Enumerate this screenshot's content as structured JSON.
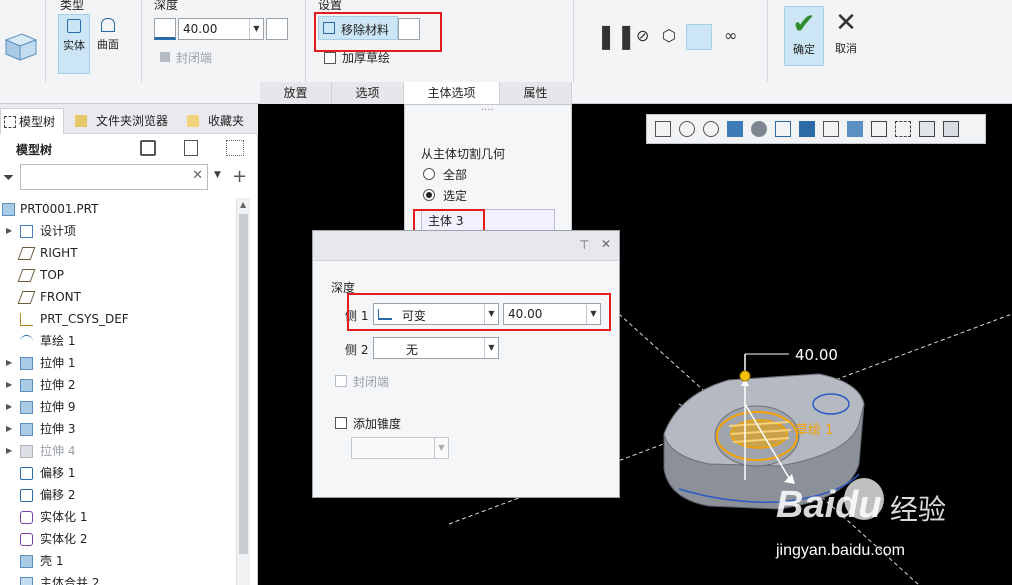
{
  "ribbon": {
    "type_group": {
      "title": "类型",
      "solid_label": "实体",
      "surface_label": "曲面"
    },
    "depth_group": {
      "title": "深度",
      "value": "40.00",
      "cap_ends_label": "封闭端"
    },
    "settings_group": {
      "title": "设置",
      "remove_material_label": "移除材料",
      "thicken_label": "加厚草绘"
    },
    "tabs": [
      {
        "label": "放置"
      },
      {
        "label": "选项"
      },
      {
        "label": "主体选项"
      },
      {
        "label": "属性"
      }
    ],
    "ok_label": "确定",
    "cancel_label": "取消"
  },
  "left_panel": {
    "tabs": [
      {
        "label": "模型树"
      },
      {
        "label": "文件夹浏览器"
      },
      {
        "label": "收藏夹"
      }
    ],
    "tree_title": "模型树",
    "filter_placeholder": "",
    "tree": [
      {
        "label": "PRT0001.PRT",
        "icon": "part-icon"
      },
      {
        "label": "设计项",
        "icon": "design-items-icon"
      },
      {
        "label": "RIGHT",
        "icon": "datum-plane-icon"
      },
      {
        "label": "TOP",
        "icon": "datum-plane-icon"
      },
      {
        "label": "FRONT",
        "icon": "datum-plane-icon"
      },
      {
        "label": "PRT_CSYS_DEF",
        "icon": "csys-icon"
      },
      {
        "label": "草绘 1",
        "icon": "sketch-icon"
      },
      {
        "label": "拉伸 1",
        "icon": "extrude-icon"
      },
      {
        "label": "拉伸 2",
        "icon": "extrude-icon"
      },
      {
        "label": "拉伸 9",
        "icon": "extrude-icon"
      },
      {
        "label": "拉伸 3",
        "icon": "extrude-icon"
      },
      {
        "label": "拉伸 4",
        "icon": "extrude-icon"
      },
      {
        "label": "偏移 1",
        "icon": "offset-icon"
      },
      {
        "label": "偏移 2",
        "icon": "offset-icon"
      },
      {
        "label": "实体化 1",
        "icon": "solidify-icon"
      },
      {
        "label": "实体化 2",
        "icon": "solidify-icon"
      },
      {
        "label": "壳 1",
        "icon": "shell-icon"
      },
      {
        "label": "主体合并 2",
        "icon": "body-merge-icon"
      }
    ]
  },
  "body_options": {
    "section_label": "从主体切割几何",
    "option_all": "全部",
    "option_selected": "选定",
    "selected_value": "选定",
    "selected_body": "主体 3"
  },
  "depth_dialog": {
    "section_label": "深度",
    "side1_label": "侧 1",
    "side1_type": "可变",
    "side1_value": "40.00",
    "side2_label": "侧 2",
    "side2_type": "无",
    "cap_ends_label": "封闭端",
    "add_taper_label": "添加锥度"
  },
  "viewport": {
    "dimension_label": "40.00",
    "sketch_label": "草绘 1"
  },
  "watermark": {
    "brand": "Baidu",
    "brand_cn": "经验",
    "url": "jingyan.baidu.com"
  },
  "colors": {
    "accent": "#2a6aa6",
    "highlight": "#e21d1d",
    "selection": "#f4a300"
  }
}
